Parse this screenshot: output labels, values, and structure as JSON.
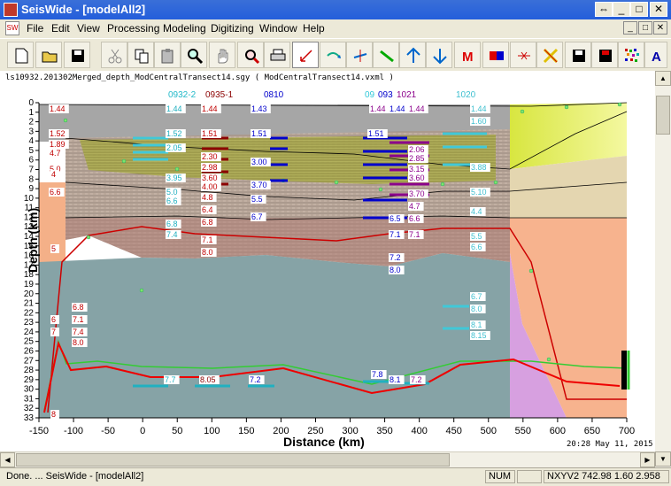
{
  "window": {
    "title": "SeisWide - [modelAll2]",
    "btn_restore": "⇔",
    "btn_min": "_",
    "btn_max": "□",
    "btn_close": "✕"
  },
  "doc_icon_text": "SW",
  "menu": {
    "items": [
      {
        "label": "File"
      },
      {
        "label": "Edit"
      },
      {
        "label": "View"
      },
      {
        "label": "Processing"
      },
      {
        "label": "Modeling"
      },
      {
        "label": "Digitizing"
      },
      {
        "label": "Window"
      },
      {
        "label": "Help"
      }
    ],
    "mdi_min": "_",
    "mdi_max": "□",
    "mdi_close": "✕"
  },
  "toolbar": {
    "buttons": [
      {
        "icon": "new-file-icon"
      },
      {
        "icon": "open-folder-icon"
      },
      {
        "icon": "save-icon"
      },
      {
        "icon": "cut-icon"
      },
      {
        "icon": "copy-icon"
      },
      {
        "icon": "paste-icon"
      },
      {
        "icon": "zoom-icon"
      },
      {
        "icon": "pan-hand-icon"
      },
      {
        "icon": "zoom-out-icon"
      },
      {
        "icon": "print-icon"
      },
      {
        "icon": "pick-arrow-icon"
      },
      {
        "icon": "curve-arrow-icon"
      },
      {
        "icon": "node-move-icon"
      },
      {
        "icon": "green-line-icon"
      },
      {
        "icon": "arrow-up-icon"
      },
      {
        "icon": "arrow-down-icon"
      },
      {
        "icon": "m-icon",
        "text": "M"
      },
      {
        "icon": "color-blocks-icon"
      },
      {
        "icon": "delete-node-icon"
      },
      {
        "icon": "cross-yellow-icon"
      },
      {
        "icon": "save-model-icon"
      },
      {
        "icon": "save-red-icon"
      },
      {
        "icon": "noise-icon"
      },
      {
        "icon": "text-icon",
        "text": "A"
      }
    ]
  },
  "pathbar": {
    "text": "ls10932.201302Merged_depth_ModCentralTransect14.sgy  ( ModCentralTransect14.vxml )"
  },
  "plot": {
    "x_axis_title": "Distance (km)",
    "y_axis_title": "Depth (km)",
    "x_ticks": [
      "-150",
      "-100",
      "-50",
      "0",
      "50",
      "100",
      "150",
      "200",
      "250",
      "300",
      "350",
      "400",
      "450",
      "500",
      "550",
      "600",
      "650",
      "700"
    ],
    "y_ticks": [
      "0",
      "1",
      "2",
      "3",
      "4",
      "5",
      "6",
      "7",
      "8",
      "9",
      "10",
      "11",
      "12",
      "13",
      "14",
      "15",
      "16",
      "17",
      "18",
      "19",
      "20",
      "21",
      "22",
      "23",
      "24",
      "25",
      "26",
      "27",
      "28",
      "29",
      "30",
      "31",
      "32",
      "33"
    ],
    "timestamp": "20:28 May 11, 2015",
    "obs_labels": [
      {
        "text": "0932-2",
        "color": "#20b8c8"
      },
      {
        "text": "0935-1",
        "color": "#8b0000"
      },
      {
        "text": "0810",
        "color": "#0000cc"
      },
      {
        "text": "09",
        "color": "#30c8d8"
      },
      {
        "text": "093",
        "color": "#0000cc"
      },
      {
        "text": "1021",
        "color": "#8b008b"
      },
      {
        "text": "1020",
        "color": "#40c0d0"
      }
    ],
    "velocity_labels": [
      {
        "text": "1.44",
        "color": "#c00000"
      },
      {
        "text": "1.52",
        "color": "#c00000"
      },
      {
        "text": "1.89",
        "color": "#c00000"
      },
      {
        "text": "4.7",
        "color": "#c00000"
      },
      {
        "text": "5.0",
        "color": "#c00000"
      },
      {
        "text": "6.6",
        "color": "#c00000"
      },
      {
        "text": "1.44",
        "color": "#20b0c0"
      },
      {
        "text": "1.52",
        "color": "#20b0c0"
      },
      {
        "text": "2.05",
        "color": "#20b0c0"
      },
      {
        "text": "3.95",
        "color": "#20b0c0"
      },
      {
        "text": "5.0",
        "color": "#20b0c0"
      },
      {
        "text": "6.6",
        "color": "#20b0c0"
      },
      {
        "text": "6.8",
        "color": "#20b0c0"
      },
      {
        "text": "7.4",
        "color": "#20b0c0"
      },
      {
        "text": "1.44",
        "color": "#c00000"
      },
      {
        "text": "1.51",
        "color": "#c00000"
      },
      {
        "text": "2.30",
        "color": "#c00000"
      },
      {
        "text": "2.98",
        "color": "#c00000"
      },
      {
        "text": "3.60",
        "color": "#c00000"
      },
      {
        "text": "4.00",
        "color": "#c00000"
      },
      {
        "text": "4.8",
        "color": "#c00000"
      },
      {
        "text": "6.4",
        "color": "#c00000"
      },
      {
        "text": "6.8",
        "color": "#c00000"
      },
      {
        "text": "7.1",
        "color": "#c00000"
      },
      {
        "text": "8.0",
        "color": "#c00000"
      },
      {
        "text": "1.43",
        "color": "#0000cc"
      },
      {
        "text": "1.51",
        "color": "#0000cc"
      },
      {
        "text": "3.00",
        "color": "#0000cc"
      },
      {
        "text": "3.70",
        "color": "#0000cc"
      },
      {
        "text": "5.5",
        "color": "#0000cc"
      },
      {
        "text": "6.7",
        "color": "#0000cc"
      },
      {
        "text": "1.44",
        "color": "#8b008b"
      },
      {
        "text": "1.44",
        "color": "#0000cc"
      },
      {
        "text": "1.51",
        "color": "#0000cc"
      },
      {
        "text": "1.44",
        "color": "#8b008b"
      },
      {
        "text": "2.06",
        "color": "#8b008b"
      },
      {
        "text": "2.85",
        "color": "#8b008b"
      },
      {
        "text": "3.15",
        "color": "#8b008b"
      },
      {
        "text": "3.60",
        "color": "#8b008b"
      },
      {
        "text": "3.70",
        "color": "#8b008b"
      },
      {
        "text": "4.7",
        "color": "#8b008b"
      },
      {
        "text": "6.5",
        "color": "#0000cc"
      },
      {
        "text": "6.6",
        "color": "#8b008b"
      },
      {
        "text": "7.1",
        "color": "#0000cc"
      },
      {
        "text": "7.1",
        "color": "#8b008b"
      },
      {
        "text": "7.2",
        "color": "#0000cc"
      },
      {
        "text": "8.0",
        "color": "#0000cc"
      },
      {
        "text": "1.44",
        "color": "#40c0d0"
      },
      {
        "text": "1.60",
        "color": "#40c0d0"
      },
      {
        "text": "3.88",
        "color": "#40c0d0"
      },
      {
        "text": "5.10",
        "color": "#40c0d0"
      },
      {
        "text": "4.4",
        "color": "#40c0d0"
      },
      {
        "text": "5.5",
        "color": "#40c0d0"
      },
      {
        "text": "6.6",
        "color": "#40c0d0"
      },
      {
        "text": "6.7",
        "color": "#40c0d0"
      },
      {
        "text": "8.0",
        "color": "#40c0d0"
      },
      {
        "text": "8.1",
        "color": "#40c0d0"
      },
      {
        "text": "8.15",
        "color": "#40c0d0"
      },
      {
        "text": "6.8",
        "color": "#c00000"
      },
      {
        "text": "7.1",
        "color": "#c00000"
      },
      {
        "text": "7.4",
        "color": "#c00000"
      },
      {
        "text": "8.0",
        "color": "#c00000"
      },
      {
        "text": "6",
        "color": "#c00000"
      },
      {
        "text": "7",
        "color": "#c00000"
      },
      {
        "text": "5",
        "color": "#c00000"
      },
      {
        "text": "4",
        "color": "#c00000"
      },
      {
        "text": "8",
        "color": "#c00000"
      },
      {
        "text": "7.7",
        "color": "#20b0c0"
      },
      {
        "text": "8.05",
        "color": "#8b0000"
      },
      {
        "text": "7.2",
        "color": "#0000cc"
      },
      {
        "text": "7.8",
        "color": "#0000cc"
      },
      {
        "text": "8.1",
        "color": "#0000cc"
      },
      {
        "text": "7.2",
        "color": "#8b008b"
      }
    ]
  },
  "statusbar": {
    "message": "Done. ... SeisWide - [modelAll2]",
    "num": "NUM",
    "coords": "NXYV2 742.98 1.60 2.958"
  }
}
